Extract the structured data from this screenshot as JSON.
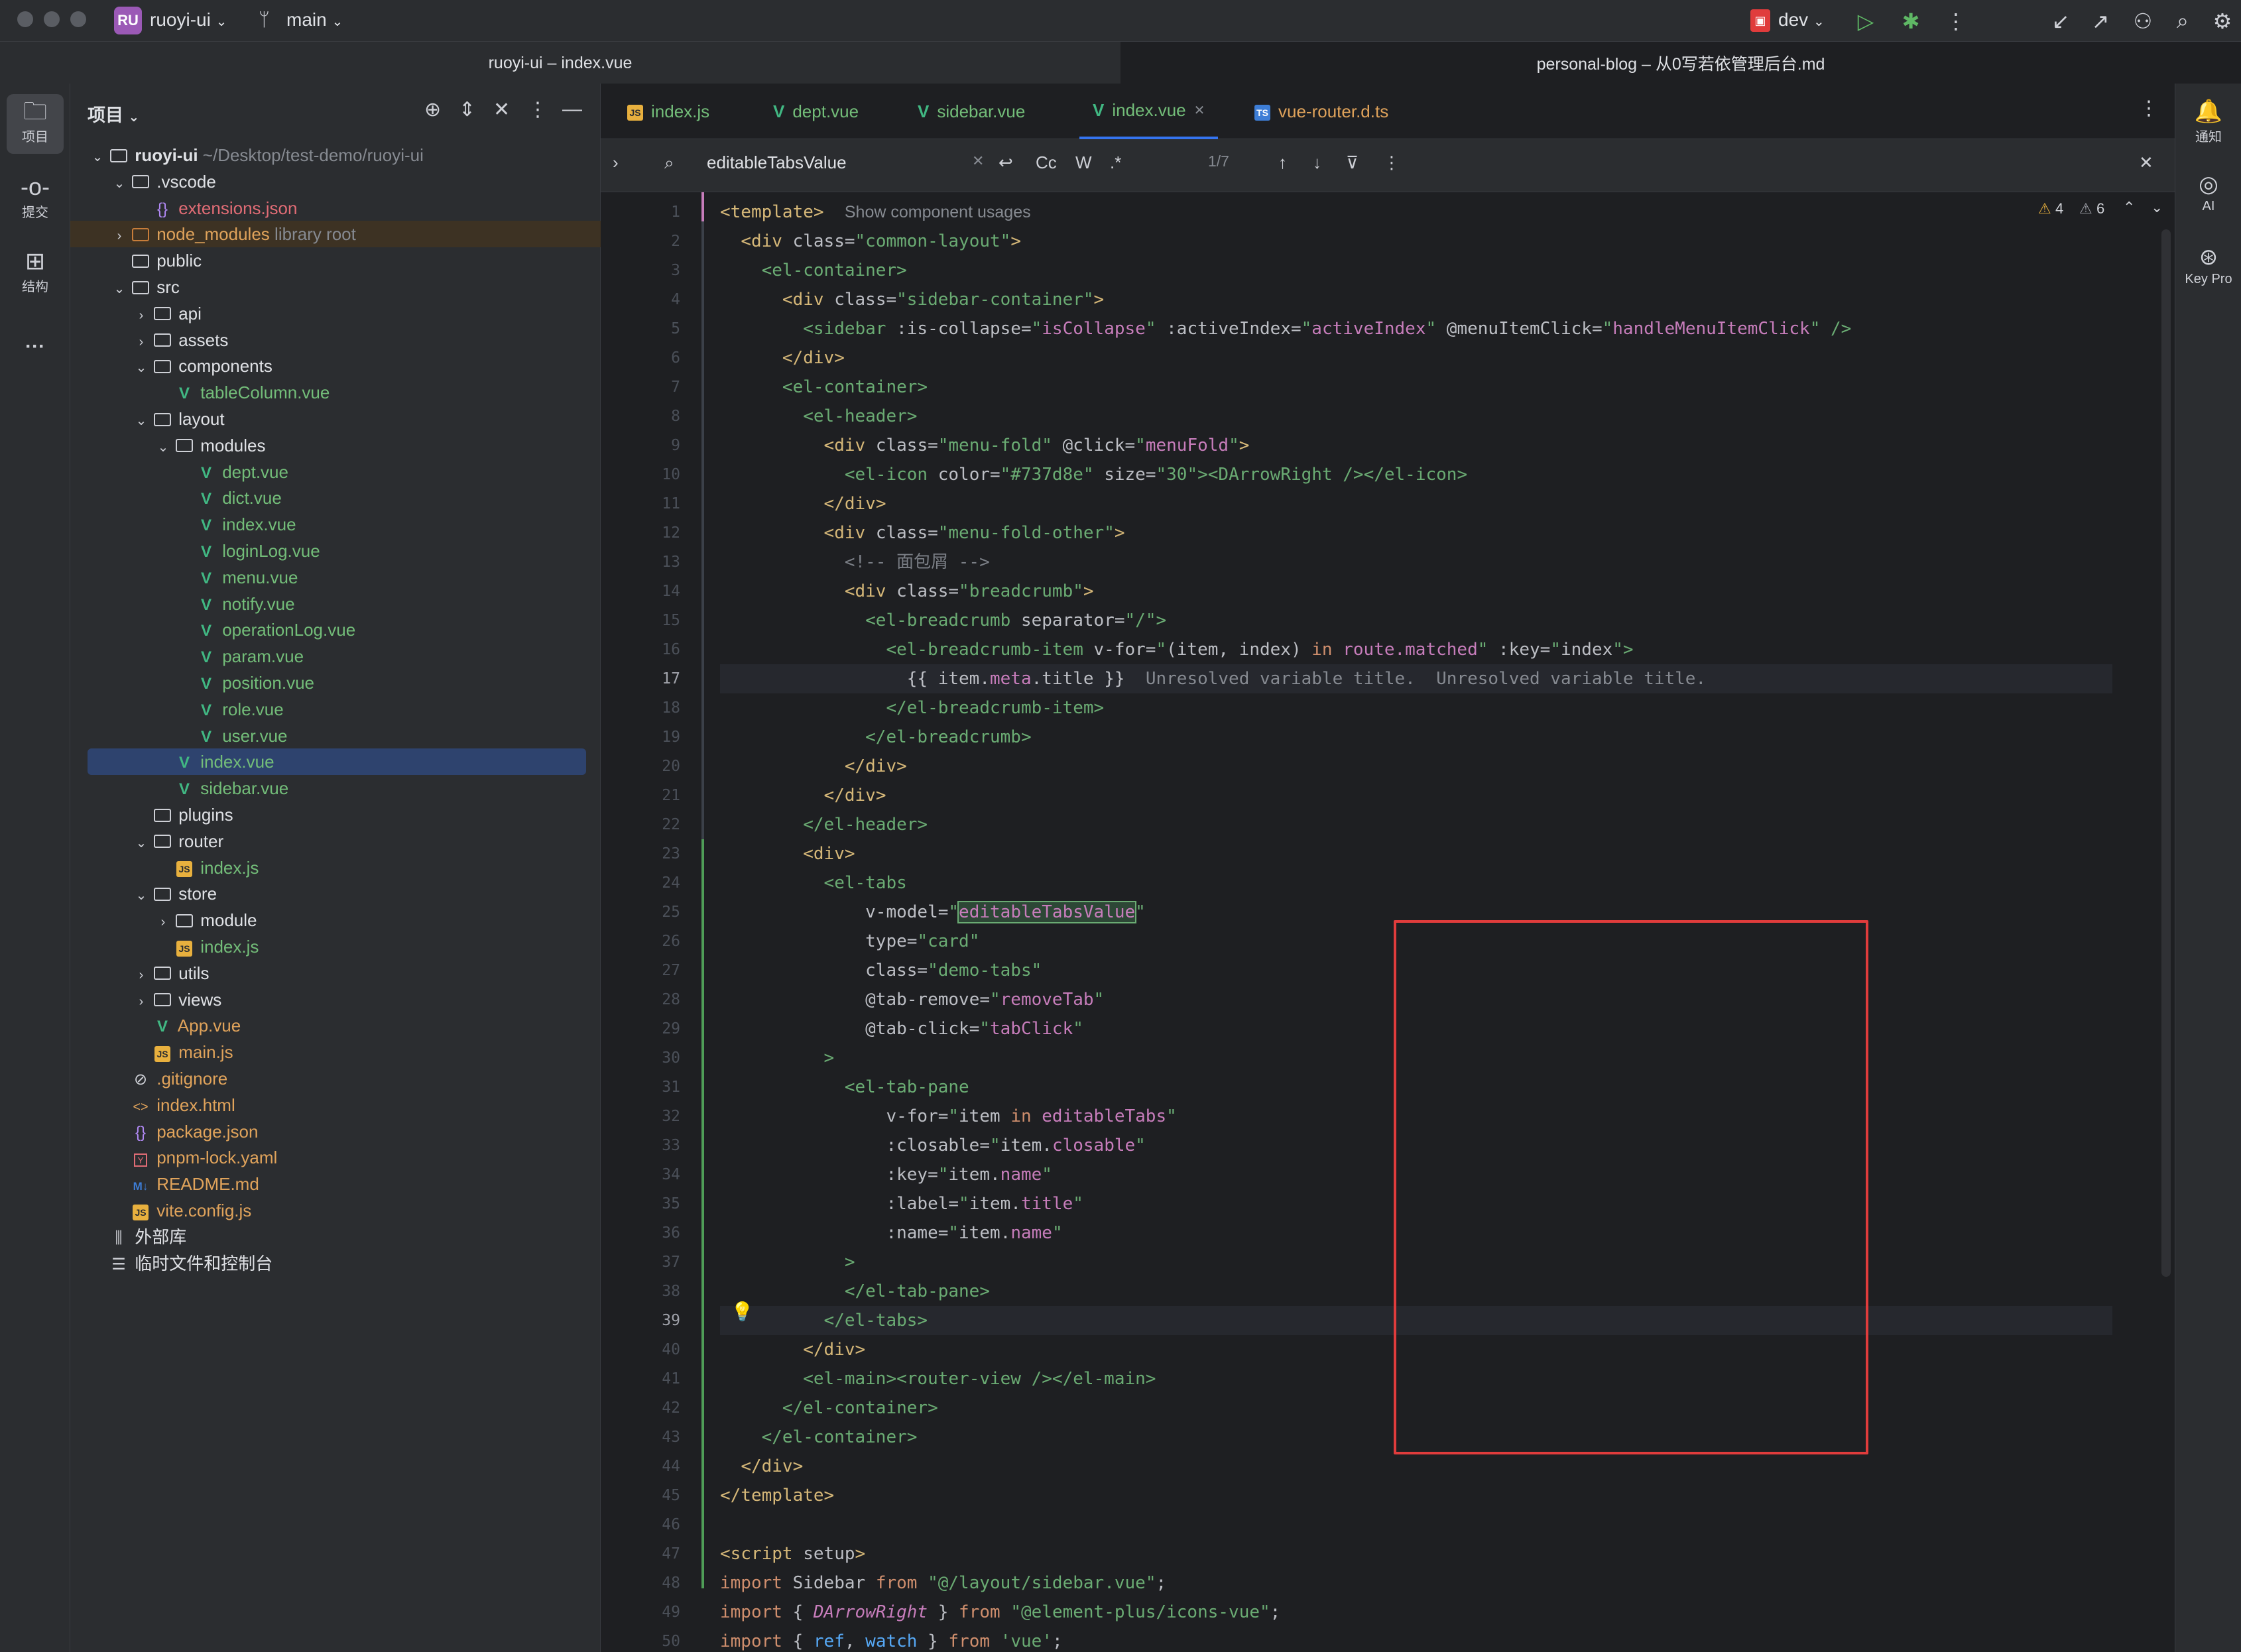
{
  "topbar": {
    "project_badge": "RU",
    "project_name": "ruoyi-ui",
    "branch": "main",
    "run_config": "dev"
  },
  "window_titles": {
    "left": "ruoyi-ui – index.vue",
    "right": "personal-blog – 从0写若依管理后台.md"
  },
  "left_strip": {
    "project": "项目",
    "commit": "提交",
    "structure": "结构",
    "more": "···"
  },
  "right_strip": {
    "notifications": "通知",
    "ai": "AI",
    "key_promoter": "Key Pro"
  },
  "project_panel": {
    "title": "项目",
    "tree": [
      {
        "label": "ruoyi-ui",
        "extra": "~/Desktop/test-demo/ruoyi-ui",
        "depth": 0,
        "type": "folder",
        "open": true,
        "bold": true
      },
      {
        "label": ".vscode",
        "depth": 1,
        "type": "folder",
        "open": true
      },
      {
        "label": "extensions.json",
        "depth": 2,
        "type": "json",
        "color": "red"
      },
      {
        "label": "node_modules",
        "extra": "library root",
        "depth": 1,
        "type": "folder-org",
        "open": false,
        "color": "orange",
        "lib": true
      },
      {
        "label": "public",
        "depth": 1,
        "type": "folder",
        "leaf": true
      },
      {
        "label": "src",
        "depth": 1,
        "type": "folder",
        "open": true
      },
      {
        "label": "api",
        "depth": 2,
        "type": "folder",
        "open": false
      },
      {
        "label": "assets",
        "depth": 2,
        "type": "folder",
        "open": false
      },
      {
        "label": "components",
        "depth": 2,
        "type": "folder",
        "open": true
      },
      {
        "label": "tableColumn.vue",
        "depth": 3,
        "type": "vue",
        "color": "green"
      },
      {
        "label": "layout",
        "depth": 2,
        "type": "folder",
        "open": true
      },
      {
        "label": "modules",
        "depth": 3,
        "type": "folder",
        "open": true
      },
      {
        "label": "dept.vue",
        "depth": 4,
        "type": "vue",
        "color": "green"
      },
      {
        "label": "dict.vue",
        "depth": 4,
        "type": "vue",
        "color": "green"
      },
      {
        "label": "index.vue",
        "depth": 4,
        "type": "vue",
        "color": "green"
      },
      {
        "label": "loginLog.vue",
        "depth": 4,
        "type": "vue",
        "color": "green"
      },
      {
        "label": "menu.vue",
        "depth": 4,
        "type": "vue",
        "color": "green"
      },
      {
        "label": "notify.vue",
        "depth": 4,
        "type": "vue",
        "color": "green"
      },
      {
        "label": "operationLog.vue",
        "depth": 4,
        "type": "vue",
        "color": "green"
      },
      {
        "label": "param.vue",
        "depth": 4,
        "type": "vue",
        "color": "green"
      },
      {
        "label": "position.vue",
        "depth": 4,
        "type": "vue",
        "color": "green"
      },
      {
        "label": "role.vue",
        "depth": 4,
        "type": "vue",
        "color": "green"
      },
      {
        "label": "user.vue",
        "depth": 4,
        "type": "vue",
        "color": "green"
      },
      {
        "label": "index.vue",
        "depth": 3,
        "type": "vue",
        "color": "green",
        "selected": true
      },
      {
        "label": "sidebar.vue",
        "depth": 3,
        "type": "vue",
        "color": "green"
      },
      {
        "label": "plugins",
        "depth": 2,
        "type": "folder",
        "leaf": true
      },
      {
        "label": "router",
        "depth": 2,
        "type": "folder",
        "open": true
      },
      {
        "label": "index.js",
        "depth": 3,
        "type": "js",
        "color": "green"
      },
      {
        "label": "store",
        "depth": 2,
        "type": "folder",
        "open": true
      },
      {
        "label": "module",
        "depth": 3,
        "type": "folder",
        "open": false
      },
      {
        "label": "index.js",
        "depth": 3,
        "type": "js",
        "color": "green"
      },
      {
        "label": "utils",
        "depth": 2,
        "type": "folder",
        "open": false
      },
      {
        "label": "views",
        "depth": 2,
        "type": "folder",
        "open": false
      },
      {
        "label": "App.vue",
        "depth": 2,
        "type": "vue",
        "color": "orange"
      },
      {
        "label": "main.js",
        "depth": 2,
        "type": "js",
        "color": "orange"
      },
      {
        "label": ".gitignore",
        "depth": 1,
        "type": "ignore",
        "color": "orange"
      },
      {
        "label": "index.html",
        "depth": 1,
        "type": "html",
        "color": "orange"
      },
      {
        "label": "package.json",
        "depth": 1,
        "type": "json",
        "color": "orange"
      },
      {
        "label": "pnpm-lock.yaml",
        "depth": 1,
        "type": "yaml",
        "color": "orange"
      },
      {
        "label": "README.md",
        "depth": 1,
        "type": "md",
        "color": "orange"
      },
      {
        "label": "vite.config.js",
        "depth": 1,
        "type": "js",
        "color": "orange"
      },
      {
        "label": "外部库",
        "depth": 0,
        "type": "lib",
        "leaf": true
      },
      {
        "label": "临时文件和控制台",
        "depth": 0,
        "type": "scratch",
        "leaf": true
      }
    ]
  },
  "editor_tabs": [
    {
      "label": "index.js",
      "icon": "js"
    },
    {
      "label": "dept.vue",
      "icon": "vue"
    },
    {
      "label": "sidebar.vue",
      "icon": "vue"
    },
    {
      "label": "index.vue",
      "icon": "vue",
      "active": true
    },
    {
      "label": "vue-router.d.ts",
      "icon": "ts"
    }
  ],
  "find_bar": {
    "query": "editableTabsValue",
    "case": "Cc",
    "words": "W",
    "regex": ".*",
    "count": "1/7"
  },
  "inspections": {
    "warnings": "4",
    "weak_warnings": "6"
  },
  "code_lines": [
    {
      "n": "1",
      "html": "<span class='t'>&lt;template&gt;</span>  <span class='hint'>Show component usages</span>"
    },
    {
      "n": "2",
      "html": "  <span class='t'>&lt;div</span> <span class='a'>class=</span><span class='s'>\"common-layout\"</span><span class='t'>&gt;</span>"
    },
    {
      "n": "3",
      "html": "    <span class='tgreen'>&lt;el-container&gt;</span>"
    },
    {
      "n": "4",
      "html": "      <span class='t'>&lt;div</span> <span class='a'>class=</span><span class='s'>\"sidebar-container\"</span><span class='t'>&gt;</span>"
    },
    {
      "n": "5",
      "html": "        <span class='tgreen'>&lt;sidebar</span> <span class='a'>:is-collapse=</span><span class='s'>\"</span><span class='pink'>isCollapse</span><span class='s'>\"</span> <span class='a'>:activeIndex=</span><span class='s'>\"</span><span class='pink'>activeIndex</span><span class='s'>\"</span> <span class='a'>@menuItemClick=</span><span class='s'>\"</span><span class='pink'>handleMenuItemClick</span><span class='s'>\"</span> <span class='tgreen'>/&gt;</span>"
    },
    {
      "n": "6",
      "html": "      <span class='t'>&lt;/div&gt;</span>"
    },
    {
      "n": "7",
      "html": "      <span class='tgreen'>&lt;el-container&gt;</span>"
    },
    {
      "n": "8",
      "html": "        <span class='tgreen'>&lt;el-header&gt;</span>"
    },
    {
      "n": "9",
      "html": "          <span class='t'>&lt;div</span> <span class='a'>class=</span><span class='s'>\"menu-fold\"</span> <span class='a'>@click=</span><span class='s'>\"</span><span class='pink'>menuFold</span><span class='s'>\"</span><span class='t'>&gt;</span>"
    },
    {
      "n": "10",
      "html": "            <span class='tgreen'>&lt;el-icon</span> <span class='a'>color=</span><span class='s'>\"#737d8e\"</span> <span class='a'>size=</span><span class='s'>\"30\"</span><span class='tgreen'>&gt;&lt;DArrowRight /&gt;&lt;/el-icon&gt;</span>"
    },
    {
      "n": "11",
      "html": "          <span class='t'>&lt;/div&gt;</span>"
    },
    {
      "n": "12",
      "html": "          <span class='t'>&lt;div</span> <span class='a'>class=</span><span class='s'>\"menu-fold-other\"</span><span class='t'>&gt;</span>"
    },
    {
      "n": "13",
      "html": "            <span class='cm'>&lt;!-- 面包屑 --&gt;</span>"
    },
    {
      "n": "14",
      "html": "            <span class='t'>&lt;div</span> <span class='a'>class=</span><span class='s'>\"breadcrumb\"</span><span class='t'>&gt;</span>"
    },
    {
      "n": "15",
      "html": "              <span class='tgreen'>&lt;el-breadcrumb</span> <span class='a'>separator=</span><span class='s'>\"/\"</span><span class='tgreen'>&gt;</span>"
    },
    {
      "n": "16",
      "html": "                <span class='tgreen'>&lt;el-breadcrumb-item</span> <span class='a'>v-for=</span><span class='s'>\"</span><span class='a'>(item, index) </span><span class='k'>in</span><span class='pink'> route.matched</span><span class='s'>\"</span> <span class='a'>:key=</span><span class='s'>\"</span><span class='a'>index</span><span class='s'>\"</span><span class='tgreen'>&gt;</span>"
    },
    {
      "n": "17",
      "html": "                  <span class='a'>{{ item.</span><span class='pink'>meta</span><span class='a'>.title }}</span>  <span class='err'>Unresolved variable title.  Unresolved variable title.</span>",
      "current": true
    },
    {
      "n": "18",
      "html": "                <span class='tgreen'>&lt;/el-breadcrumb-item&gt;</span>"
    },
    {
      "n": "19",
      "html": "              <span class='tgreen'>&lt;/el-breadcrumb&gt;</span>"
    },
    {
      "n": "20",
      "html": "            <span class='t'>&lt;/div&gt;</span>"
    },
    {
      "n": "21",
      "html": "          <span class='t'>&lt;/div&gt;</span>"
    },
    {
      "n": "22",
      "html": "        <span class='tgreen'>&lt;/el-header&gt;</span>"
    },
    {
      "n": "23",
      "html": "        <span class='t'>&lt;div&gt;</span>"
    },
    {
      "n": "24",
      "html": "          <span class='tgreen'>&lt;el-tabs</span>"
    },
    {
      "n": "25",
      "html": "              <span class='a'>v-model=</span><span class='s'>\"</span><span class='hl pink'>editableTabsValue</span><span class='s'>\"</span>"
    },
    {
      "n": "26",
      "html": "              <span class='a'>type=</span><span class='s'>\"card\"</span>"
    },
    {
      "n": "27",
      "html": "              <span class='a'>class=</span><span class='s'>\"demo-tabs\"</span>"
    },
    {
      "n": "28",
      "html": "              <span class='a'>@tab-remove=</span><span class='s'>\"</span><span class='pink'>removeTab</span><span class='s'>\"</span>"
    },
    {
      "n": "29",
      "html": "              <span class='a'>@tab-click=</span><span class='s'>\"</span><span class='pink'>tabClick</span><span class='s'>\"</span>"
    },
    {
      "n": "30",
      "html": "          <span class='tgreen'>&gt;</span>"
    },
    {
      "n": "31",
      "html": "            <span class='tgreen'>&lt;el-tab-pane</span>"
    },
    {
      "n": "32",
      "html": "                <span class='a'>v-for=</span><span class='s'>\"</span><span class='a'>item </span><span class='k'>in</span><span class='pink'> editableTabs</span><span class='s'>\"</span>"
    },
    {
      "n": "33",
      "html": "                <span class='a'>:closable=</span><span class='s'>\"</span><span class='a'>item.</span><span class='pink'>closable</span><span class='s'>\"</span>"
    },
    {
      "n": "34",
      "html": "                <span class='a'>:key=</span><span class='s'>\"</span><span class='a'>item.</span><span class='pink'>name</span><span class='s'>\"</span>"
    },
    {
      "n": "35",
      "html": "                <span class='a'>:label=</span><span class='s'>\"</span><span class='a'>item.</span><span class='pink'>title</span><span class='s'>\"</span>"
    },
    {
      "n": "36",
      "html": "                <span class='a'>:name=</span><span class='s'>\"</span><span class='a'>item.</span><span class='pink'>name</span><span class='s'>\"</span>"
    },
    {
      "n": "37",
      "html": "            <span class='tgreen'>&gt;</span>"
    },
    {
      "n": "38",
      "html": "            <span class='tgreen'>&lt;/el-tab-pane&gt;</span>"
    },
    {
      "n": "39",
      "html": "          <span class='tgreen'>&lt;/el-tabs&gt;</span>",
      "current": true
    },
    {
      "n": "40",
      "html": "        <span class='t'>&lt;/div&gt;</span>"
    },
    {
      "n": "41",
      "html": "        <span class='tgreen'>&lt;el-main&gt;&lt;router-view /&gt;&lt;/el-main&gt;</span>"
    },
    {
      "n": "42",
      "html": "      <span class='tgreen'>&lt;/el-container&gt;</span>"
    },
    {
      "n": "43",
      "html": "    <span class='tgreen'>&lt;/el-container&gt;</span>"
    },
    {
      "n": "44",
      "html": "  <span class='t'>&lt;/div&gt;</span>"
    },
    {
      "n": "45",
      "html": "<span class='t'>&lt;/template&gt;</span>"
    },
    {
      "n": "46",
      "html": ""
    },
    {
      "n": "47",
      "html": "<span class='t'>&lt;script</span> <span class='a'>setup</span><span class='t'>&gt;</span>"
    },
    {
      "n": "48",
      "html": "<span class='k'>import</span> <span class='a'>Sidebar</span> <span class='k'>from</span> <span class='s'>\"@/layout/sidebar.vue\"</span><span class='a'>;</span>"
    },
    {
      "n": "49",
      "html": "<span class='k'>import</span> <span class='a'>{ </span><span class='pink'><i>DArrowRight</i></span><span class='a'> } </span><span class='k'>from</span> <span class='s'>\"@element-plus/icons-vue\"</span><span class='a'>;</span>"
    },
    {
      "n": "50",
      "html": "<span class='k'>import</span> <span class='a'>{ </span><span class='teal'>ref</span><span class='a'>, </span><span class='teal'>watch</span><span class='a'> } </span><span class='k'>from</span> <span class='s'>'vue'</span><span class='a'>;</span>"
    }
  ]
}
